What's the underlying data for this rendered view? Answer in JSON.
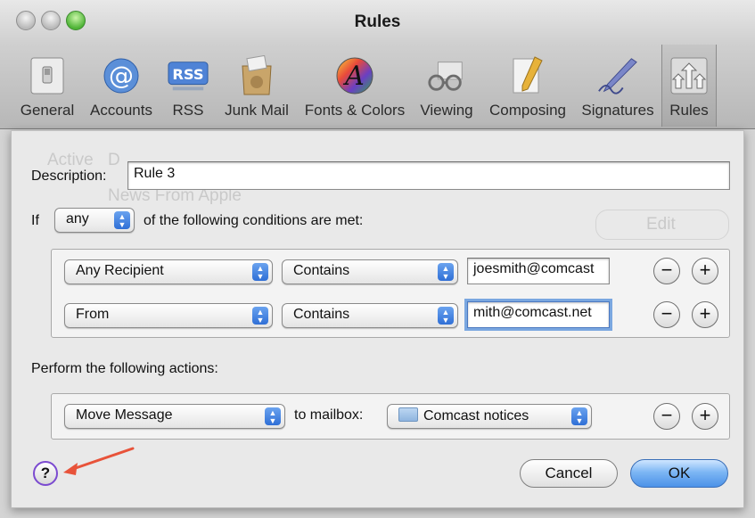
{
  "window": {
    "title": "Rules"
  },
  "toolbar": {
    "items": [
      {
        "label": "General",
        "icon": "switch-icon"
      },
      {
        "label": "Accounts",
        "icon": "at-sign-icon"
      },
      {
        "label": "RSS",
        "icon": "rss-icon"
      },
      {
        "label": "Junk Mail",
        "icon": "junk-mail-icon"
      },
      {
        "label": "Fonts & Colors",
        "icon": "font-color-icon"
      },
      {
        "label": "Viewing",
        "icon": "glasses-icon"
      },
      {
        "label": "Composing",
        "icon": "pencil-icon"
      },
      {
        "label": "Signatures",
        "icon": "signature-pen-icon"
      },
      {
        "label": "Rules",
        "icon": "rules-arrows-icon"
      }
    ],
    "active": "Rules"
  },
  "rule": {
    "description_label": "Description:",
    "description_value": "Rule 3",
    "if_label": "If",
    "match_select": "any",
    "conditions_suffix": "of the following conditions are met:",
    "conditions": [
      {
        "field": "Any Recipient",
        "operator": "Contains",
        "value": "joesmith@comcast"
      },
      {
        "field": "From",
        "operator": "Contains",
        "value": "mith@comcast.net"
      }
    ],
    "actions_label": "Perform the following actions:",
    "actions": [
      {
        "action": "Move Message",
        "to_label": "to mailbox:",
        "mailbox": "Comcast notices"
      }
    ]
  },
  "buttons": {
    "remove_symbol": "−",
    "add_symbol": "+",
    "help": "?",
    "cancel": "Cancel",
    "ok": "OK"
  },
  "background_ghost": {
    "col_active": "Active",
    "col_desc": "D",
    "item": "News From Apple",
    "edit": "Edit"
  },
  "colors": {
    "accent_blue": "#4c92e8",
    "annotation_arrow": "#e8533a",
    "help_ring": "#7b4ad0"
  }
}
